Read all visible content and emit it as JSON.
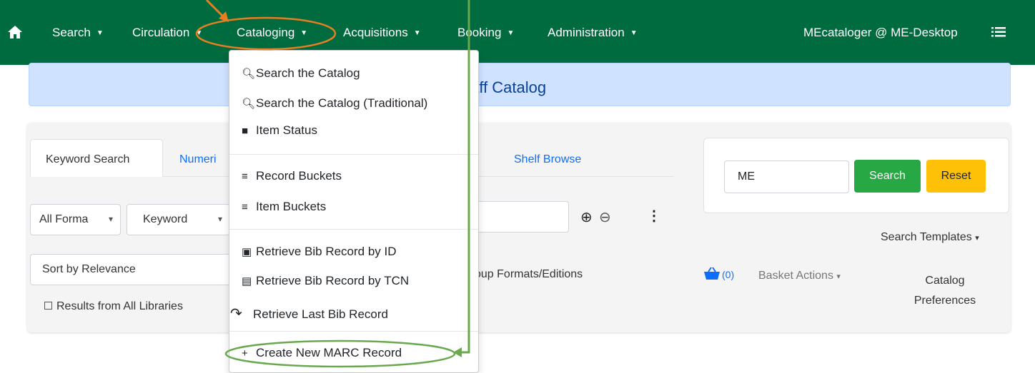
{
  "nav": {
    "items": [
      "Search",
      "Circulation",
      "Cataloging",
      "Acquisitions",
      "Booking",
      "Administration"
    ],
    "user": "MEcataloger @ ME-Desktop"
  },
  "banner": {
    "title": "taff Catalog"
  },
  "tabs": {
    "keyword": "Keyword Search",
    "numeric": "Numeri",
    "shelf": "Shelf Browse"
  },
  "search": {
    "format": "All Forma",
    "field": "Keyword",
    "sort": "Sort by Relevance",
    "all_libraries": "Results from All Libraries",
    "group_formats": "oup Formats/Editions"
  },
  "right": {
    "query": "ME",
    "search_button": "Search",
    "reset_button": "Reset",
    "templates": "Search Templates",
    "basket_count": "(0)",
    "basket_actions": "Basket Actions",
    "prefs_line1": "Catalog",
    "prefs_line2": "Preferences"
  },
  "dropdown": {
    "search_catalog": "Search the Catalog",
    "search_traditional": "Search the Catalog (Traditional)",
    "item_status": "Item Status",
    "record_buckets": "Record Buckets",
    "item_buckets": "Item Buckets",
    "retrieve_id": "Retrieve Bib Record by ID",
    "retrieve_tcn": "Retrieve Bib Record by TCN",
    "retrieve_last": "Retrieve Last Bib Record",
    "create_marc": "Create New MARC Record"
  },
  "colors": {
    "navbar": "#006b3f",
    "search_button": "#28a745",
    "reset_button": "#ffc107",
    "annotation_orange": "#e67e22",
    "annotation_green": "#6aa84f"
  }
}
